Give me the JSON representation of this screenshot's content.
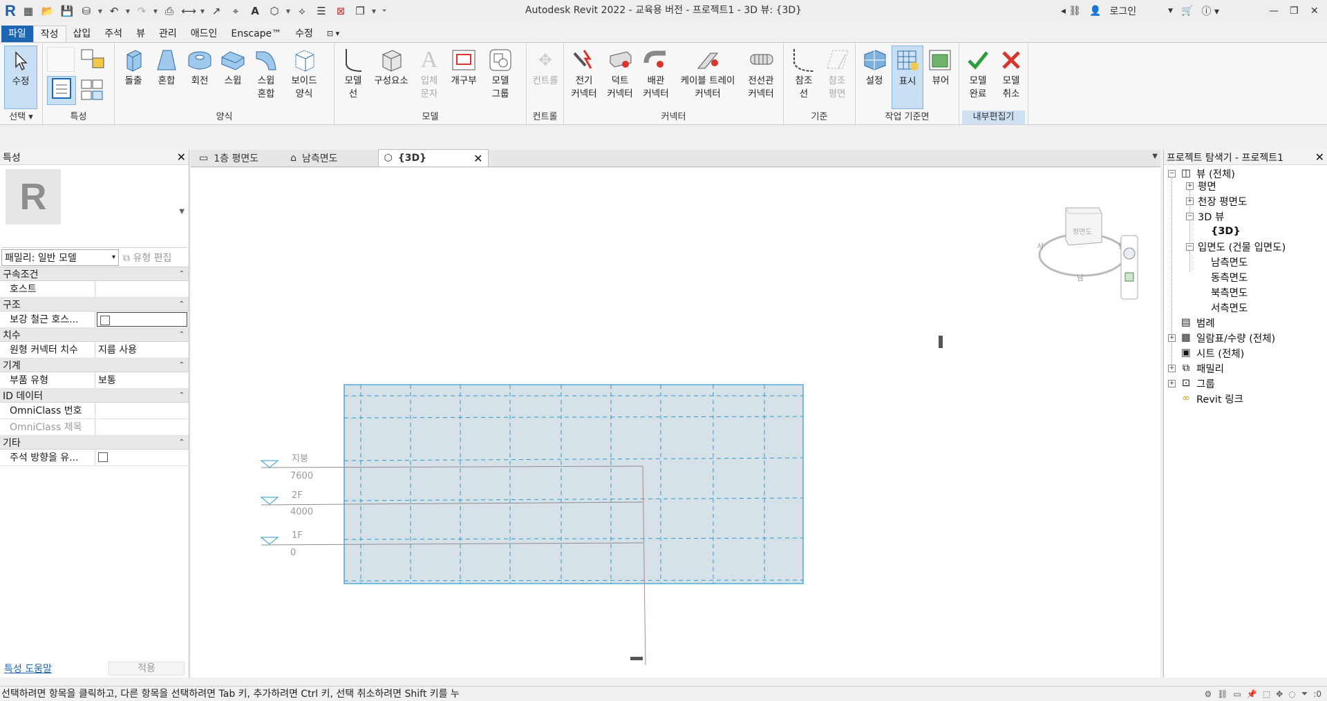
{
  "app": {
    "title": "Autodesk Revit 2022 - 교육용 버전 - 프로젝트1 - 3D 뷰: {3D}",
    "login": "로그인"
  },
  "ribbon_tabs": [
    {
      "label": "파일"
    },
    {
      "label": "작성"
    },
    {
      "label": "삽입"
    },
    {
      "label": "주석"
    },
    {
      "label": "뷰"
    },
    {
      "label": "관리"
    },
    {
      "label": "애드인"
    },
    {
      "label": "Enscape™"
    },
    {
      "label": "수정"
    }
  ],
  "ribbon": {
    "select": {
      "modify": "수정",
      "group": "선택"
    },
    "properties_group": "특성",
    "forms": {
      "extrusion": "돌출",
      "blend": "혼합",
      "revolve": "회전",
      "sweep": "스윕",
      "swept_blend": "스윕\n혼합",
      "void_forms": "보이드\n양식",
      "group": "양식"
    },
    "model": {
      "model_line": "모델\n선",
      "component": "구성요소",
      "model_text": "입체\n문자",
      "opening": "개구부",
      "model_group": "모델\n그룹",
      "group": "모델"
    },
    "control": {
      "control": "컨트롤",
      "group": "컨트롤"
    },
    "connectors": {
      "electrical": "전기\n커넥터",
      "duct": "덕트\n커넥터",
      "pipe": "배관\n커넥터",
      "cable_tray": "케이블 트레이\n커넥터",
      "conduit": "전선관\n커넥터",
      "group": "커넥터"
    },
    "datum": {
      "ref_line": "참조\n선",
      "ref_plane": "참조\n평면",
      "group": "기준"
    },
    "work_plane": {
      "set": "설정",
      "show": "표시",
      "viewer": "뷰어",
      "group": "작업 기준면"
    },
    "in_place": {
      "finish": "모델\n완료",
      "cancel": "모델\n취소",
      "group": "내부편집기"
    }
  },
  "properties": {
    "title": "특성",
    "family_selector": "패밀리: 일반 모델",
    "edit_type": "유형 편집",
    "categories": [
      {
        "name": "구속조건",
        "rows": [
          {
            "key": "호스트",
            "value": ""
          }
        ]
      },
      {
        "name": "구조",
        "rows": [
          {
            "key": "보강 철근 호스...",
            "value": "",
            "checkbox": true
          }
        ]
      },
      {
        "name": "치수",
        "rows": [
          {
            "key": "원형 커넥터 치수",
            "value": "지름 사용"
          }
        ]
      },
      {
        "name": "기계",
        "rows": [
          {
            "key": "부품 유형",
            "value": "보통"
          }
        ]
      },
      {
        "name": "ID 데이터",
        "rows": [
          {
            "key": "OmniClass 번호",
            "value": ""
          },
          {
            "key": "OmniClass 제목",
            "value": ""
          }
        ]
      },
      {
        "name": "기타",
        "rows": [
          {
            "key": "주석 방향을 유...",
            "value": "",
            "checkbox": true
          }
        ]
      }
    ],
    "help_link": "특성 도움말",
    "apply": "적용"
  },
  "view_tabs": [
    {
      "label": "1층 평면도"
    },
    {
      "label": "남측면도"
    },
    {
      "label": "{3D}"
    }
  ],
  "levels": [
    {
      "name": "지붕",
      "elevation": "7600"
    },
    {
      "name": "2F",
      "elevation": "4000"
    },
    {
      "name": "1F",
      "elevation": "0"
    }
  ],
  "viewcube_face": "정면도",
  "project_browser": {
    "title": "프로젝트 탐색기 - 프로젝트1",
    "items": [
      {
        "label": "뷰 (전체)"
      },
      {
        "label": "평면"
      },
      {
        "label": "천장 평면도"
      },
      {
        "label": "3D 뷰"
      },
      {
        "label": "{3D}"
      },
      {
        "label": "입면도 (건물 입면도)"
      },
      {
        "label": "남측면도"
      },
      {
        "label": "동측면도"
      },
      {
        "label": "북측면도"
      },
      {
        "label": "서측면도"
      },
      {
        "label": "범례"
      },
      {
        "label": "일람표/수량 (전체)"
      },
      {
        "label": "시트 (전체)"
      },
      {
        "label": "패밀리"
      },
      {
        "label": "그룹"
      },
      {
        "label": "Revit 링크"
      }
    ]
  },
  "status": {
    "message": "선택하려면 항목을 클릭하고, 다른 항목을 선택하려면 Tab 키, 추가하려면 Ctrl 키, 선택 취소하려면 Shift 키를 누",
    "filter_count": ":0"
  },
  "colors": {
    "accent": "#1a66b4",
    "plane_fill": "#d6e1e8",
    "plane_edge": "#2a9ad0",
    "finish_green": "#2e9c3a",
    "cancel_red": "#d9342b"
  }
}
